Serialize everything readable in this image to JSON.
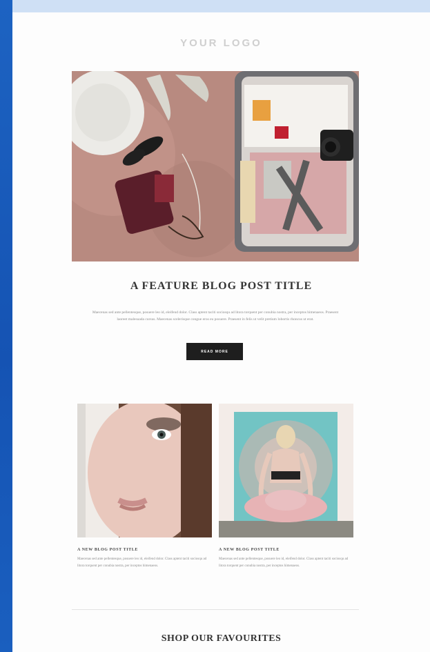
{
  "header": {
    "logo_text": "YOUR LOGO"
  },
  "feature": {
    "title": "A FEATURE BLOG POST TITLE",
    "excerpt": "Maecenas sed ante pellentesque, posuere leo id, eleifend dolor. Class aptent taciti sociosqu ad litora torquent per conubia nostra, per inceptos himenaeos. Praesent laoreet malesuada cursus. Maecenas scelerisque congue eros eu posuere. Praesent in felis ut velit pretium lobortis rhoncus ut erat.",
    "button_label": "READ MORE"
  },
  "posts": [
    {
      "title": "A NEW BLOG POST TITLE",
      "excerpt": "Maecenas sed ante pellentesque, posuere leo id, eleifend dolor. Class aptent taciti sociosqu ad litora torquent per conubia nostra, per inceptos himenaeos."
    },
    {
      "title": "A NEW BLOG POST TITLE",
      "excerpt": "Maecenas sed ante pellentesque, posuere leo id, eleifend dolor. Class aptent taciti sociosqu ad litora torquent per conubia nostra, per inceptos himenaeos."
    }
  ],
  "shop": {
    "title": "SHOP OUR FAVOURITES"
  },
  "colors": {
    "frame": "#1553b3",
    "page": "#fdfdfd",
    "button": "#1e1e1e",
    "accent_pink": "#b88a80"
  },
  "icons": [
    "hero-image",
    "portrait-image",
    "yoga-image"
  ]
}
